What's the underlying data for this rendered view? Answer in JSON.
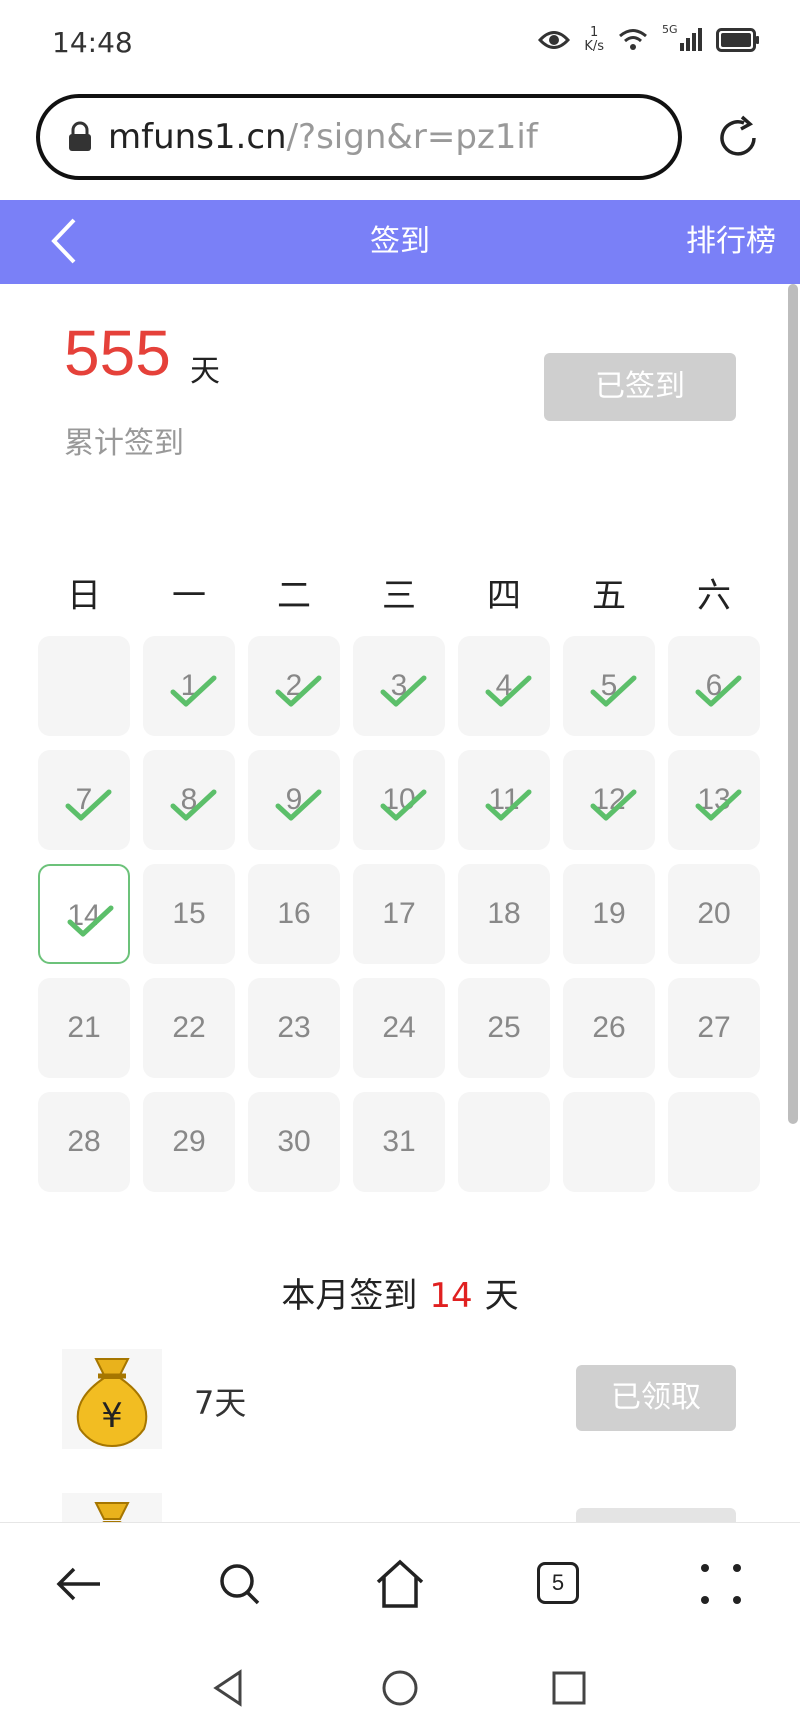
{
  "status_bar": {
    "time": "14:48",
    "net_speed_value": "1",
    "net_speed_unit": "K/s",
    "signal_label": "5G"
  },
  "url_bar": {
    "host": "mfuns1.cn",
    "path": "/?sign&r=pz1if"
  },
  "header": {
    "title": "签到",
    "ranking": "排行榜"
  },
  "summary": {
    "total_days": "555",
    "day_unit": "天",
    "total_label": "累计签到",
    "signed_button": "已签到"
  },
  "calendar": {
    "weekdays": [
      "日",
      "一",
      "二",
      "三",
      "四",
      "五",
      "六"
    ],
    "today": 14,
    "checked_days": [
      1,
      2,
      3,
      4,
      5,
      6,
      7,
      8,
      9,
      10,
      11,
      12,
      13,
      14
    ],
    "rows": [
      [
        "",
        "1",
        "2",
        "3",
        "4",
        "5",
        "6"
      ],
      [
        "7",
        "8",
        "9",
        "10",
        "11",
        "12",
        "13"
      ],
      [
        "14",
        "15",
        "16",
        "17",
        "18",
        "19",
        "20"
      ],
      [
        "21",
        "22",
        "23",
        "24",
        "25",
        "26",
        "27"
      ],
      [
        "28",
        "29",
        "30",
        "31",
        "",
        "",
        ""
      ]
    ]
  },
  "month_summary": {
    "prefix": "本月签到",
    "days": "14",
    "suffix": "天"
  },
  "rewards": [
    {
      "label": "7天",
      "button": "已领取"
    }
  ],
  "bottom_nav": {
    "tab_count": "5"
  },
  "colors": {
    "header_bg": "#7a80f7",
    "accent_red": "#e5413a",
    "check_green": "#5cbf6a"
  }
}
